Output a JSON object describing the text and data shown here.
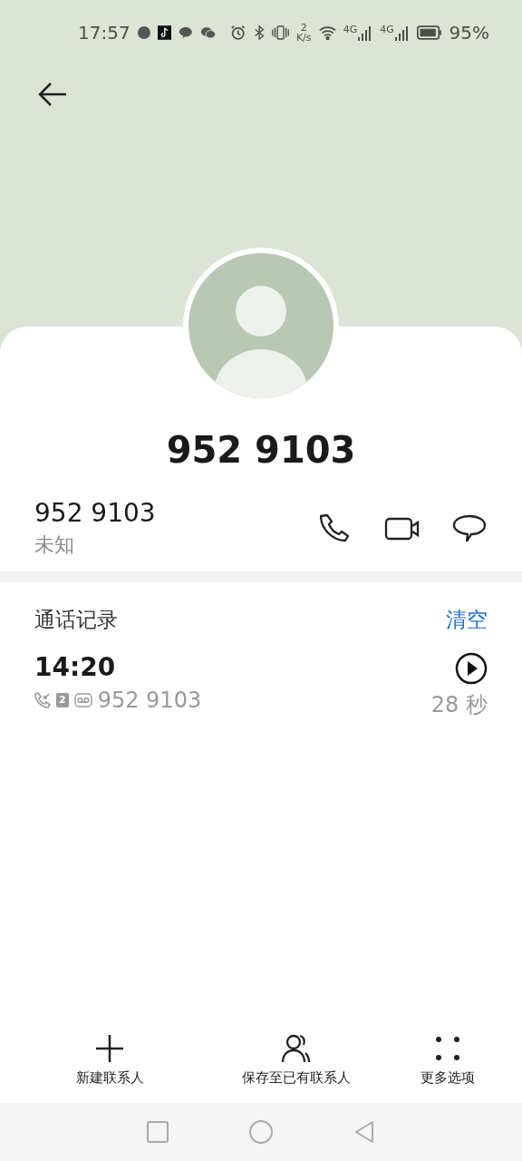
{
  "status_bar": {
    "time": "17:57",
    "speed_value": "2",
    "speed_unit": "K/s",
    "network": [
      "4G",
      "4G"
    ],
    "battery": "95%"
  },
  "contact": {
    "name": "952 9103"
  },
  "number": {
    "value": "952 9103",
    "label": "未知"
  },
  "call_log": {
    "title": "通话记录",
    "clear": "清空",
    "entries": [
      {
        "time": "14:20",
        "sim": "2",
        "number": "952 9103",
        "duration": "28 秒"
      }
    ]
  },
  "actions": [
    {
      "kind": "add",
      "label": "新建联系人"
    },
    {
      "kind": "person",
      "label": "保存至已有联系人"
    },
    {
      "kind": "more",
      "label": "更多选项"
    }
  ]
}
